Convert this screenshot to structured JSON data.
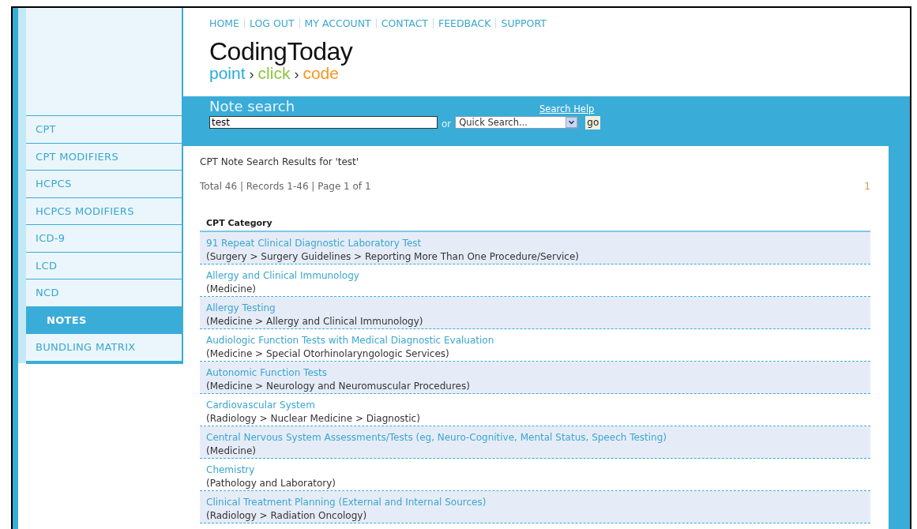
{
  "top_nav": [
    "HOME",
    "LOG OUT",
    "MY ACCOUNT",
    "CONTACT",
    "FEEDBACK",
    "SUPPORT"
  ],
  "logo": {
    "name": "CodingToday",
    "separator": "›",
    "tagline": [
      {
        "text": "point",
        "color": "#29a9e0"
      },
      {
        "text": "click",
        "color": "#8cc63f"
      },
      {
        "text": "code",
        "color": "#f7941d"
      }
    ]
  },
  "sidebar": {
    "items": [
      {
        "label": "CPT",
        "selected": false
      },
      {
        "label": "CPT MODIFIERS",
        "selected": false
      },
      {
        "label": "HCPCS",
        "selected": false
      },
      {
        "label": "HCPCS MODIFIERS",
        "selected": false
      },
      {
        "label": "ICD-9",
        "selected": false
      },
      {
        "label": "LCD",
        "selected": false
      },
      {
        "label": "NCD",
        "selected": false
      },
      {
        "label": "NOTES",
        "selected": true
      },
      {
        "label": "BUNDLING MATRIX",
        "selected": false
      }
    ]
  },
  "search": {
    "title": "Note search",
    "help": "Search Help",
    "value": "test",
    "or": "or",
    "quick_search": "Quick Search...",
    "go": "go"
  },
  "results": {
    "heading": "CPT Note Search Results for 'test'",
    "summary": "Total 46 | Records 1-46 | Page 1 of 1",
    "page": "1",
    "column": "CPT Category",
    "rows": [
      {
        "title": "91 Repeat Clinical Diagnostic Laboratory Test",
        "path": "(Surgery > Surgery Guidelines > Reporting More Than One Procedure/Service)"
      },
      {
        "title": "Allergy and Clinical Immunology",
        "path": "(Medicine)"
      },
      {
        "title": "Allergy Testing",
        "path": "(Medicine > Allergy and Clinical Immunology)"
      },
      {
        "title": "Audiologic Function Tests with Medical Diagnostic Evaluation",
        "path": "(Medicine > Special Otorhinolaryngologic Services)"
      },
      {
        "title": "Autonomic Function Tests",
        "path": "(Medicine > Neurology and Neuromuscular Procedures)"
      },
      {
        "title": "Cardiovascular System",
        "path": "(Radiology > Nuclear Medicine > Diagnostic)"
      },
      {
        "title": "Central Nervous System Assessments/Tests (eg, Neuro-Cognitive, Mental Status, Speech Testing)",
        "path": "(Medicine)"
      },
      {
        "title": "Chemistry",
        "path": "(Pathology and Laboratory)"
      },
      {
        "title": "Clinical Treatment Planning (External and Internal Sources)",
        "path": "(Radiology > Radiation Oncology)"
      }
    ]
  }
}
